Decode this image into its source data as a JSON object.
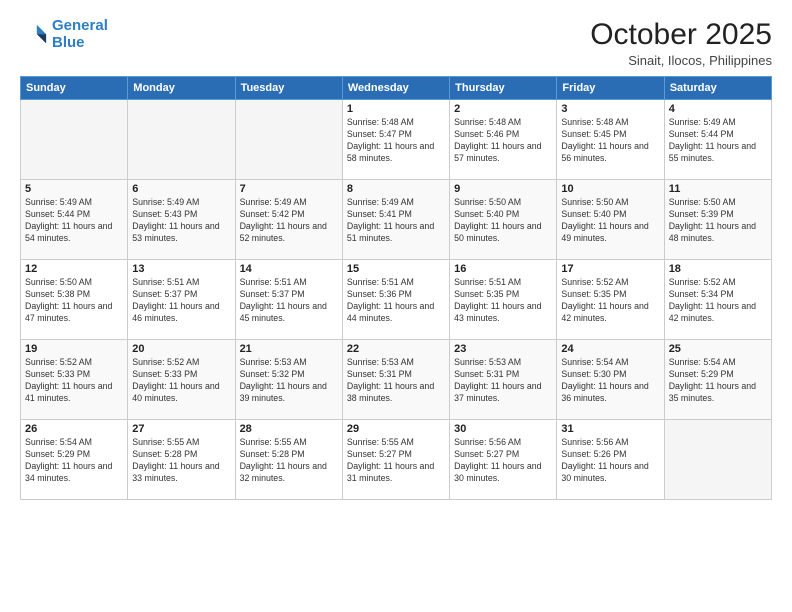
{
  "header": {
    "logo_line1": "General",
    "logo_line2": "Blue",
    "month": "October 2025",
    "location": "Sinait, Ilocos, Philippines"
  },
  "weekdays": [
    "Sunday",
    "Monday",
    "Tuesday",
    "Wednesday",
    "Thursday",
    "Friday",
    "Saturday"
  ],
  "weeks": [
    [
      {
        "day": "",
        "sunrise": "",
        "sunset": "",
        "daylight": ""
      },
      {
        "day": "",
        "sunrise": "",
        "sunset": "",
        "daylight": ""
      },
      {
        "day": "",
        "sunrise": "",
        "sunset": "",
        "daylight": ""
      },
      {
        "day": "1",
        "sunrise": "Sunrise: 5:48 AM",
        "sunset": "Sunset: 5:47 PM",
        "daylight": "Daylight: 11 hours and 58 minutes."
      },
      {
        "day": "2",
        "sunrise": "Sunrise: 5:48 AM",
        "sunset": "Sunset: 5:46 PM",
        "daylight": "Daylight: 11 hours and 57 minutes."
      },
      {
        "day": "3",
        "sunrise": "Sunrise: 5:48 AM",
        "sunset": "Sunset: 5:45 PM",
        "daylight": "Daylight: 11 hours and 56 minutes."
      },
      {
        "day": "4",
        "sunrise": "Sunrise: 5:49 AM",
        "sunset": "Sunset: 5:44 PM",
        "daylight": "Daylight: 11 hours and 55 minutes."
      }
    ],
    [
      {
        "day": "5",
        "sunrise": "Sunrise: 5:49 AM",
        "sunset": "Sunset: 5:44 PM",
        "daylight": "Daylight: 11 hours and 54 minutes."
      },
      {
        "day": "6",
        "sunrise": "Sunrise: 5:49 AM",
        "sunset": "Sunset: 5:43 PM",
        "daylight": "Daylight: 11 hours and 53 minutes."
      },
      {
        "day": "7",
        "sunrise": "Sunrise: 5:49 AM",
        "sunset": "Sunset: 5:42 PM",
        "daylight": "Daylight: 11 hours and 52 minutes."
      },
      {
        "day": "8",
        "sunrise": "Sunrise: 5:49 AM",
        "sunset": "Sunset: 5:41 PM",
        "daylight": "Daylight: 11 hours and 51 minutes."
      },
      {
        "day": "9",
        "sunrise": "Sunrise: 5:50 AM",
        "sunset": "Sunset: 5:40 PM",
        "daylight": "Daylight: 11 hours and 50 minutes."
      },
      {
        "day": "10",
        "sunrise": "Sunrise: 5:50 AM",
        "sunset": "Sunset: 5:40 PM",
        "daylight": "Daylight: 11 hours and 49 minutes."
      },
      {
        "day": "11",
        "sunrise": "Sunrise: 5:50 AM",
        "sunset": "Sunset: 5:39 PM",
        "daylight": "Daylight: 11 hours and 48 minutes."
      }
    ],
    [
      {
        "day": "12",
        "sunrise": "Sunrise: 5:50 AM",
        "sunset": "Sunset: 5:38 PM",
        "daylight": "Daylight: 11 hours and 47 minutes."
      },
      {
        "day": "13",
        "sunrise": "Sunrise: 5:51 AM",
        "sunset": "Sunset: 5:37 PM",
        "daylight": "Daylight: 11 hours and 46 minutes."
      },
      {
        "day": "14",
        "sunrise": "Sunrise: 5:51 AM",
        "sunset": "Sunset: 5:37 PM",
        "daylight": "Daylight: 11 hours and 45 minutes."
      },
      {
        "day": "15",
        "sunrise": "Sunrise: 5:51 AM",
        "sunset": "Sunset: 5:36 PM",
        "daylight": "Daylight: 11 hours and 44 minutes."
      },
      {
        "day": "16",
        "sunrise": "Sunrise: 5:51 AM",
        "sunset": "Sunset: 5:35 PM",
        "daylight": "Daylight: 11 hours and 43 minutes."
      },
      {
        "day": "17",
        "sunrise": "Sunrise: 5:52 AM",
        "sunset": "Sunset: 5:35 PM",
        "daylight": "Daylight: 11 hours and 42 minutes."
      },
      {
        "day": "18",
        "sunrise": "Sunrise: 5:52 AM",
        "sunset": "Sunset: 5:34 PM",
        "daylight": "Daylight: 11 hours and 42 minutes."
      }
    ],
    [
      {
        "day": "19",
        "sunrise": "Sunrise: 5:52 AM",
        "sunset": "Sunset: 5:33 PM",
        "daylight": "Daylight: 11 hours and 41 minutes."
      },
      {
        "day": "20",
        "sunrise": "Sunrise: 5:52 AM",
        "sunset": "Sunset: 5:33 PM",
        "daylight": "Daylight: 11 hours and 40 minutes."
      },
      {
        "day": "21",
        "sunrise": "Sunrise: 5:53 AM",
        "sunset": "Sunset: 5:32 PM",
        "daylight": "Daylight: 11 hours and 39 minutes."
      },
      {
        "day": "22",
        "sunrise": "Sunrise: 5:53 AM",
        "sunset": "Sunset: 5:31 PM",
        "daylight": "Daylight: 11 hours and 38 minutes."
      },
      {
        "day": "23",
        "sunrise": "Sunrise: 5:53 AM",
        "sunset": "Sunset: 5:31 PM",
        "daylight": "Daylight: 11 hours and 37 minutes."
      },
      {
        "day": "24",
        "sunrise": "Sunrise: 5:54 AM",
        "sunset": "Sunset: 5:30 PM",
        "daylight": "Daylight: 11 hours and 36 minutes."
      },
      {
        "day": "25",
        "sunrise": "Sunrise: 5:54 AM",
        "sunset": "Sunset: 5:29 PM",
        "daylight": "Daylight: 11 hours and 35 minutes."
      }
    ],
    [
      {
        "day": "26",
        "sunrise": "Sunrise: 5:54 AM",
        "sunset": "Sunset: 5:29 PM",
        "daylight": "Daylight: 11 hours and 34 minutes."
      },
      {
        "day": "27",
        "sunrise": "Sunrise: 5:55 AM",
        "sunset": "Sunset: 5:28 PM",
        "daylight": "Daylight: 11 hours and 33 minutes."
      },
      {
        "day": "28",
        "sunrise": "Sunrise: 5:55 AM",
        "sunset": "Sunset: 5:28 PM",
        "daylight": "Daylight: 11 hours and 32 minutes."
      },
      {
        "day": "29",
        "sunrise": "Sunrise: 5:55 AM",
        "sunset": "Sunset: 5:27 PM",
        "daylight": "Daylight: 11 hours and 31 minutes."
      },
      {
        "day": "30",
        "sunrise": "Sunrise: 5:56 AM",
        "sunset": "Sunset: 5:27 PM",
        "daylight": "Daylight: 11 hours and 30 minutes."
      },
      {
        "day": "31",
        "sunrise": "Sunrise: 5:56 AM",
        "sunset": "Sunset: 5:26 PM",
        "daylight": "Daylight: 11 hours and 30 minutes."
      },
      {
        "day": "",
        "sunrise": "",
        "sunset": "",
        "daylight": ""
      }
    ]
  ]
}
